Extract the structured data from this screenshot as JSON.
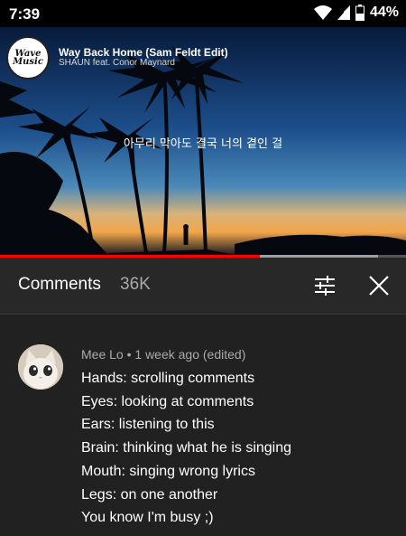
{
  "status_bar": {
    "time": "7:39",
    "battery_percent": "44%"
  },
  "video": {
    "channel_logo_text": "Wave Music",
    "title": "Way Back Home (Sam Feldt Edit)",
    "artist": "SHAUN feat. Conor Maynard",
    "lyric": "아무리 막아도 결국 너의 곁인 걸",
    "progress_fraction": 0.64,
    "buffered_fraction": 0.93
  },
  "comments_panel": {
    "title": "Comments",
    "count": "36K",
    "sort_icon": "tune-icon",
    "close_icon": "close-icon"
  },
  "comment": {
    "author": "Mee Lo",
    "separator": " • ",
    "time": "1 week ago (edited)",
    "lines": [
      "Hands: scrolling comments",
      "Eyes: looking at comments",
      "Ears: listening to this",
      "Brain: thinking what he is singing",
      "Mouth: singing wrong lyrics",
      "Legs: on one another",
      "You know I'm busy ;)"
    ]
  },
  "colors": {
    "accent": "#ff0000",
    "background": "#212121",
    "header": "#282828"
  }
}
